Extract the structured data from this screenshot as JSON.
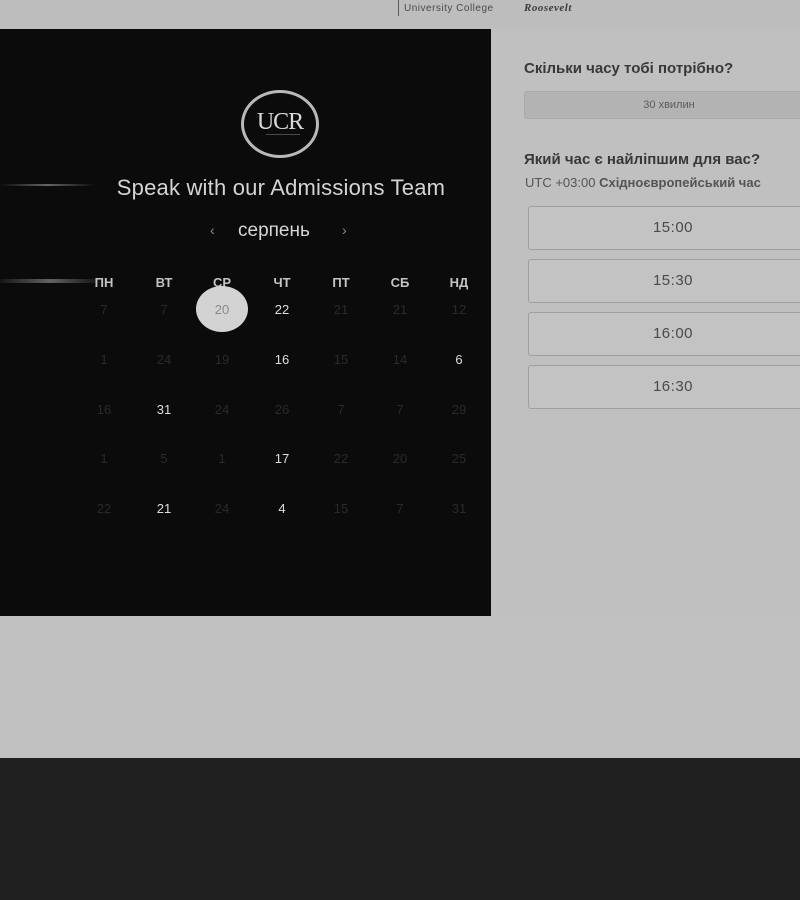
{
  "header": {
    "brand_primary": "University College",
    "brand_secondary": "Roosevelt"
  },
  "calendar": {
    "logo_text": "UCR",
    "heading": "Speak with our Admissions Team",
    "month": "серпень",
    "prev_icon": "chevron-left-icon",
    "next_icon": "chevron-right-icon",
    "weekdays": [
      "ПН",
      "ВТ",
      "СР",
      "ЧТ",
      "ПТ",
      "СБ",
      "НД"
    ],
    "selected_day": "20",
    "weeks": [
      [
        "7",
        "7",
        "20",
        "22",
        "21",
        "21",
        "12"
      ],
      [
        "1",
        "24",
        "19",
        "16",
        "15",
        "14",
        "6"
      ],
      [
        "16",
        "31",
        "24",
        "26",
        "7",
        "7",
        "29"
      ],
      [
        "1",
        "5",
        "1",
        "17",
        "22",
        "20",
        "25"
      ],
      [
        "22",
        "21",
        "24",
        "4",
        "15",
        "7",
        "31"
      ]
    ],
    "available": [
      [
        false,
        false,
        true,
        true,
        false,
        false,
        false
      ],
      [
        false,
        false,
        false,
        true,
        false,
        false,
        true
      ],
      [
        false,
        true,
        false,
        false,
        false,
        false,
        false
      ],
      [
        false,
        false,
        false,
        true,
        false,
        false,
        false
      ],
      [
        false,
        true,
        false,
        true,
        false,
        false,
        false
      ]
    ]
  },
  "booking": {
    "duration_question": "Скільки часу тобі потрібно?",
    "duration_value": "30 хвилин",
    "time_question": "Який час є найліпшим для вас?",
    "timezone_offset": "UTC +03:00",
    "timezone_name": "Східноєвропейський час",
    "slots": [
      "15:00",
      "15:30",
      "16:00",
      "16:30"
    ]
  },
  "colors": {
    "calendar_bg": "#0b0b0b",
    "panel_bg": "#c0c0c0",
    "footer_bg": "#202020",
    "selected_day_bg": "#d3d3d3"
  }
}
